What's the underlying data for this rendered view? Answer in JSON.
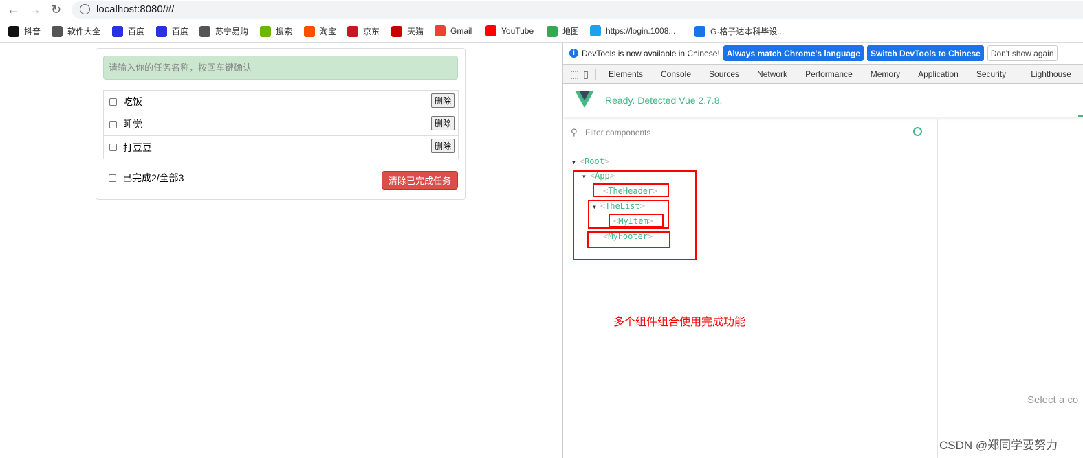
{
  "browser": {
    "url": "localhost:8080/#/",
    "bookmarks": [
      {
        "label": "抖音",
        "color": "#111"
      },
      {
        "label": "软件大全",
        "color": "#555"
      },
      {
        "label": "百度",
        "color": "#2932e1"
      },
      {
        "label": "百度",
        "color": "#2932e1"
      },
      {
        "label": "苏宁易购",
        "color": "#555"
      },
      {
        "label": "搜索",
        "color": "#6bb700"
      },
      {
        "label": "淘宝",
        "color": "#ff5000"
      },
      {
        "label": "京东",
        "color": "#c81623"
      },
      {
        "label": "天猫",
        "color": "#c40000"
      },
      {
        "label": "Gmail",
        "color": "#ea4335"
      },
      {
        "label": "YouTube",
        "color": "#ff0000"
      },
      {
        "label": "地图",
        "color": "#34a853"
      },
      {
        "label": "https://login.1008...",
        "color": "#1aa3e8"
      },
      {
        "label": "G·格子达本科毕设...",
        "color": "#1a73e8"
      }
    ]
  },
  "todo": {
    "input_placeholder": "请输入你的任务名称，按回车键确认",
    "items": [
      {
        "title": "吃饭",
        "done": false,
        "delete_label": "删除"
      },
      {
        "title": "睡觉",
        "done": false,
        "delete_label": "删除"
      },
      {
        "title": "打豆豆",
        "done": false,
        "delete_label": "删除"
      }
    ],
    "footer_text": "已完成2/全部3",
    "clear_label": "清除已完成任务",
    "input_bg": "#cce7d0",
    "danger_color": "#da4f49"
  },
  "devtools": {
    "info_text": "DevTools is now available in Chinese!",
    "btn_match": "Always match Chrome's language",
    "btn_switch": "Switch DevTools to Chinese",
    "btn_dont": "Don't show again",
    "tabs": [
      "Elements",
      "Console",
      "Sources",
      "Network",
      "Performance",
      "Memory",
      "Application",
      "Security",
      "Lighthouse"
    ],
    "ready_text": "Ready. Detected Vue 2.7.8.",
    "filter_placeholder": "Filter components",
    "tree": {
      "root": "Root",
      "app": "App",
      "header": "TheHeader",
      "list": "TheList",
      "item": "MyItem",
      "footer": "MyFooter"
    },
    "select_hint": "Select a co",
    "vue_color": "#42b883"
  },
  "annotation": "多个组件组合使用完成功能",
  "watermark": "CSDN @郑同学要努力"
}
